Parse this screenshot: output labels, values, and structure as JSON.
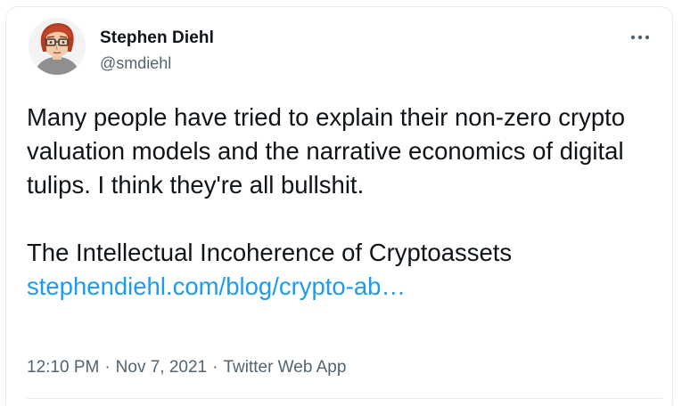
{
  "author": {
    "display_name": "Stephen Diehl",
    "handle": "@smdiehl",
    "avatar_icon": "cartoon-avatar-red-hair-glasses"
  },
  "more_icon": "more-horizontal-icon",
  "tweet": {
    "line1": "Many people have tried to explain their non-zero crypto valuation models and the narrative economics of digital tulips. I think they're all bullshit.",
    "line2": "The Intellectual Incoherence of Cryptoassets",
    "link_text": "stephendiehl.com/blog/crypto-ab…"
  },
  "meta": {
    "time": "12:10 PM",
    "separator": "·",
    "date": "Nov 7, 2021",
    "source": "Twitter Web App"
  },
  "colors": {
    "text": "#0f1419",
    "secondary": "#536471",
    "link": "#1d9bf0",
    "border": "#e6ecf0"
  }
}
